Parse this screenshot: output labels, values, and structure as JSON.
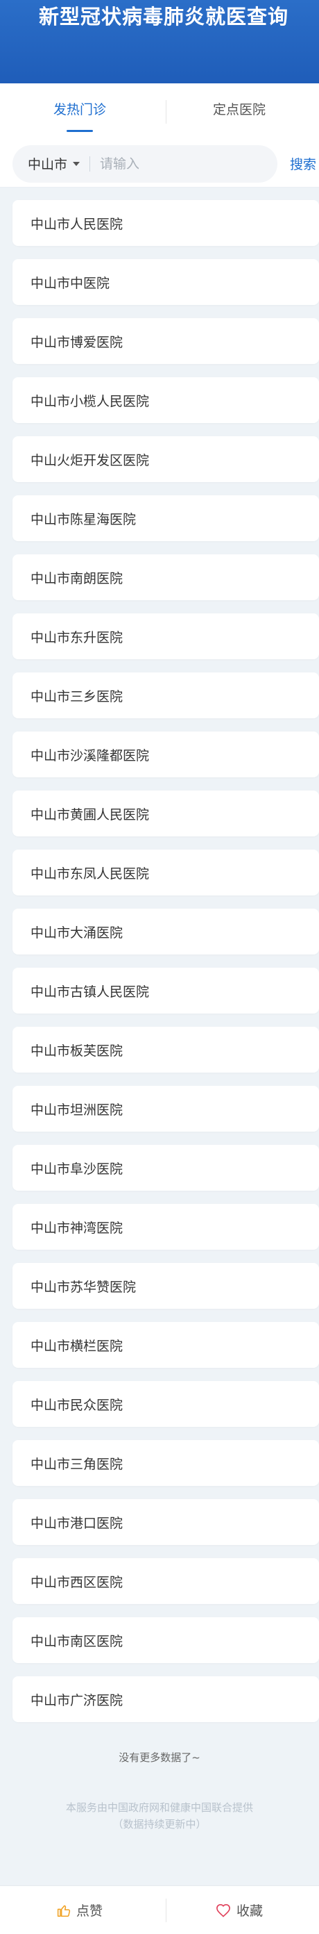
{
  "header": {
    "title": "新型冠状病毒肺炎就医查询"
  },
  "tabs": [
    {
      "label": "发热门诊",
      "active": true
    },
    {
      "label": "定点医院",
      "active": false
    }
  ],
  "search": {
    "city": "中山市",
    "placeholder": "请输入",
    "value": "",
    "button_label": "搜索"
  },
  "hospitals": [
    "中山市人民医院",
    "中山市中医院",
    "中山市博爱医院",
    "中山市小榄人民医院",
    "中山火炬开发区医院",
    "中山市陈星海医院",
    "中山市南朗医院",
    "中山市东升医院",
    "中山市三乡医院",
    "中山市沙溪隆都医院",
    "中山市黄圃人民医院",
    "中山市东凤人民医院",
    "中山市大涌医院",
    "中山市古镇人民医院",
    "中山市板芙医院",
    "中山市坦洲医院",
    "中山市阜沙医院",
    "中山市神湾医院",
    "中山市苏华赞医院",
    "中山市横栏医院",
    "中山市民众医院",
    "中山市三角医院",
    "中山市港口医院",
    "中山市西区医院",
    "中山市南区医院",
    "中山市广济医院"
  ],
  "list_footer": {
    "no_more": "没有更多数据了~",
    "source_line1": "本服务由中国政府网和健康中国联合提供",
    "source_line2": "（数据持续更新中）"
  },
  "bottom_bar": {
    "like_label": "点赞",
    "like_icon": "thumbs-up-icon",
    "favorite_label": "收藏",
    "favorite_icon": "heart-icon",
    "like_color": "#f0a020",
    "favorite_color": "#e0405a"
  },
  "colors": {
    "header_bg": "#1f5db9",
    "accent": "#1f6fd0",
    "page_bg": "#eef3f7"
  }
}
